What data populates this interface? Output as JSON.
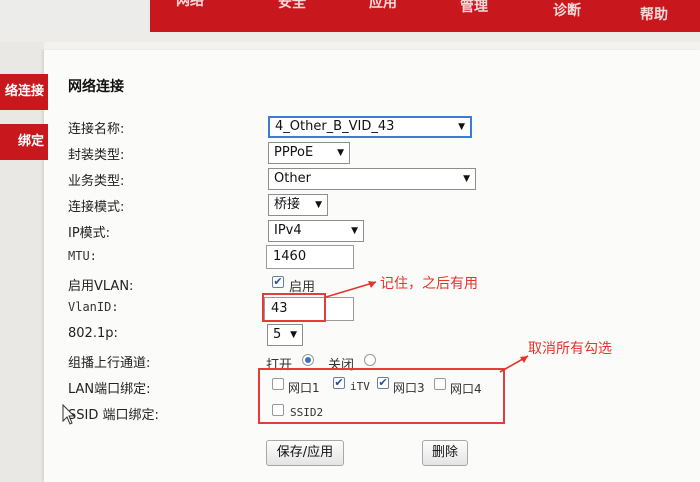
{
  "nav": {
    "items": [
      "网络",
      "安全",
      "应用",
      "管理",
      "诊断",
      "帮助"
    ]
  },
  "sidebar": {
    "items": [
      {
        "label": "络连接"
      },
      {
        "label": "绑定"
      }
    ]
  },
  "section_title": "网络连接",
  "form": {
    "connection_name": {
      "label": "连接名称:",
      "value": "4_Other_B_VID_43"
    },
    "encapsulation": {
      "label": "封装类型:",
      "value": "PPPoE"
    },
    "service_type": {
      "label": "业务类型:",
      "value": "Other"
    },
    "connection_mode": {
      "label": "连接模式:",
      "value": "桥接"
    },
    "ip_mode": {
      "label": "IP模式:",
      "value": "IPv4"
    },
    "mtu": {
      "label": "MTU:",
      "value": "1460"
    },
    "enable_vlan": {
      "label": "启用VLAN:",
      "checkbox_label": "启用",
      "checked": true
    },
    "vlan_id": {
      "label": "VlanID:",
      "value": "43"
    },
    "priority_8021p": {
      "label": "802.1p:",
      "value": "5"
    },
    "multicast_uplink": {
      "label": "组播上行通道:",
      "open_label": "打开",
      "close_label": "关闭",
      "selected": "打开"
    },
    "lan_binding": {
      "label": "LAN端口绑定:",
      "ports": [
        {
          "label": "网口1",
          "checked": false
        },
        {
          "label": "iTV",
          "checked": true
        },
        {
          "label": "网口3",
          "checked": true
        },
        {
          "label": "网口4",
          "checked": false
        }
      ]
    },
    "ssid_binding": {
      "label": "SSID 端口绑定:",
      "ports": [
        {
          "label": "SSID2",
          "checked": false
        }
      ]
    }
  },
  "buttons": {
    "save": "保存/应用",
    "delete": "删除"
  },
  "annotations": {
    "remember": "记住，之后有用",
    "uncheck_all": "取消所有勾选"
  },
  "colors": {
    "nav_red": "#c8181e",
    "annotation_red": "#e5342b",
    "focus_blue": "#3d7bd9"
  }
}
